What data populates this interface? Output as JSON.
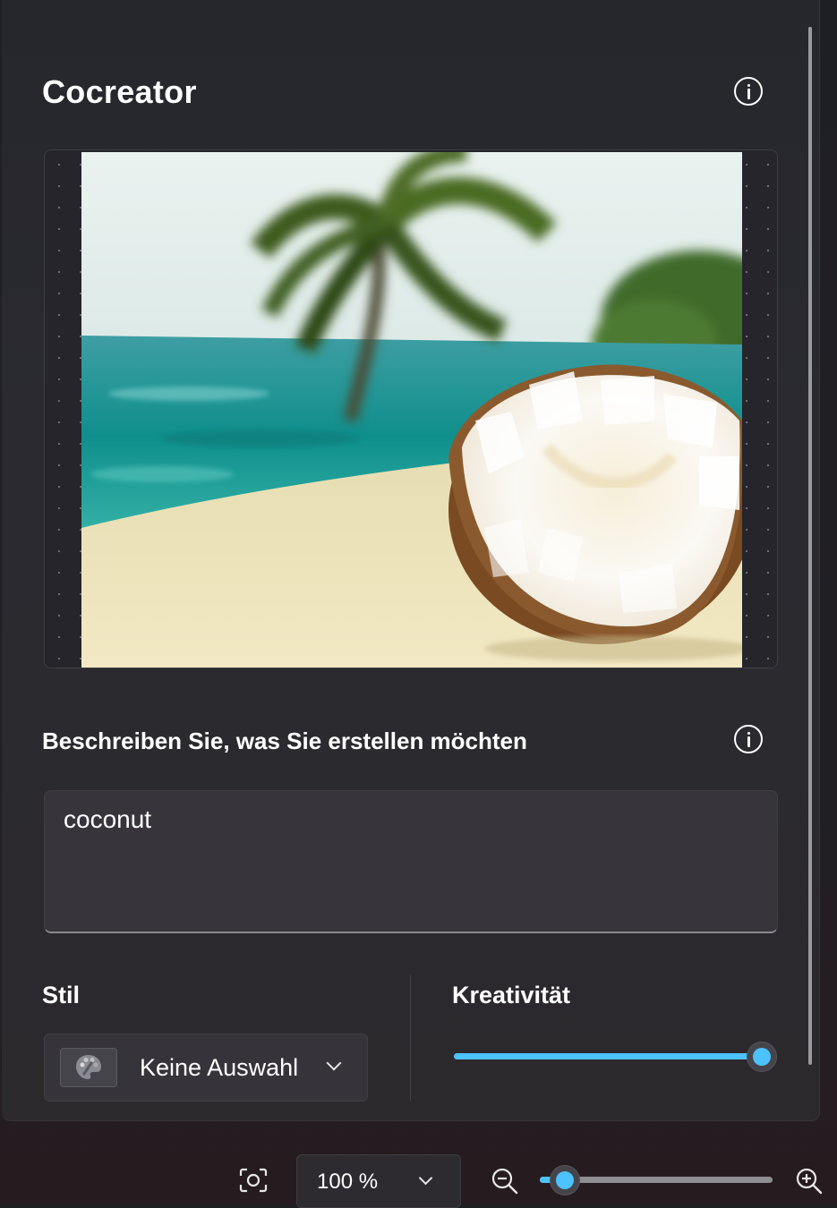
{
  "panel": {
    "title": "Cocreator"
  },
  "canvas": {
    "image_subject": "coconut-on-beach"
  },
  "prompt": {
    "label": "Beschreiben Sie, was Sie erstellen möchten",
    "value": "coconut"
  },
  "style": {
    "label": "Stil",
    "selected": "Keine Auswahl"
  },
  "creativity": {
    "label": "Kreativität",
    "level": 1.0
  },
  "zoom": {
    "value": "100 %",
    "slider_level": 0.11
  },
  "colors": {
    "accent": "#4cc2ff",
    "panel_bg": "#2a2a30",
    "text": "#ffffff"
  },
  "icons": [
    "info-icon",
    "chevron-down-icon",
    "palette-icon",
    "focus-frame-icon",
    "zoom-out-icon",
    "zoom-in-icon"
  ]
}
